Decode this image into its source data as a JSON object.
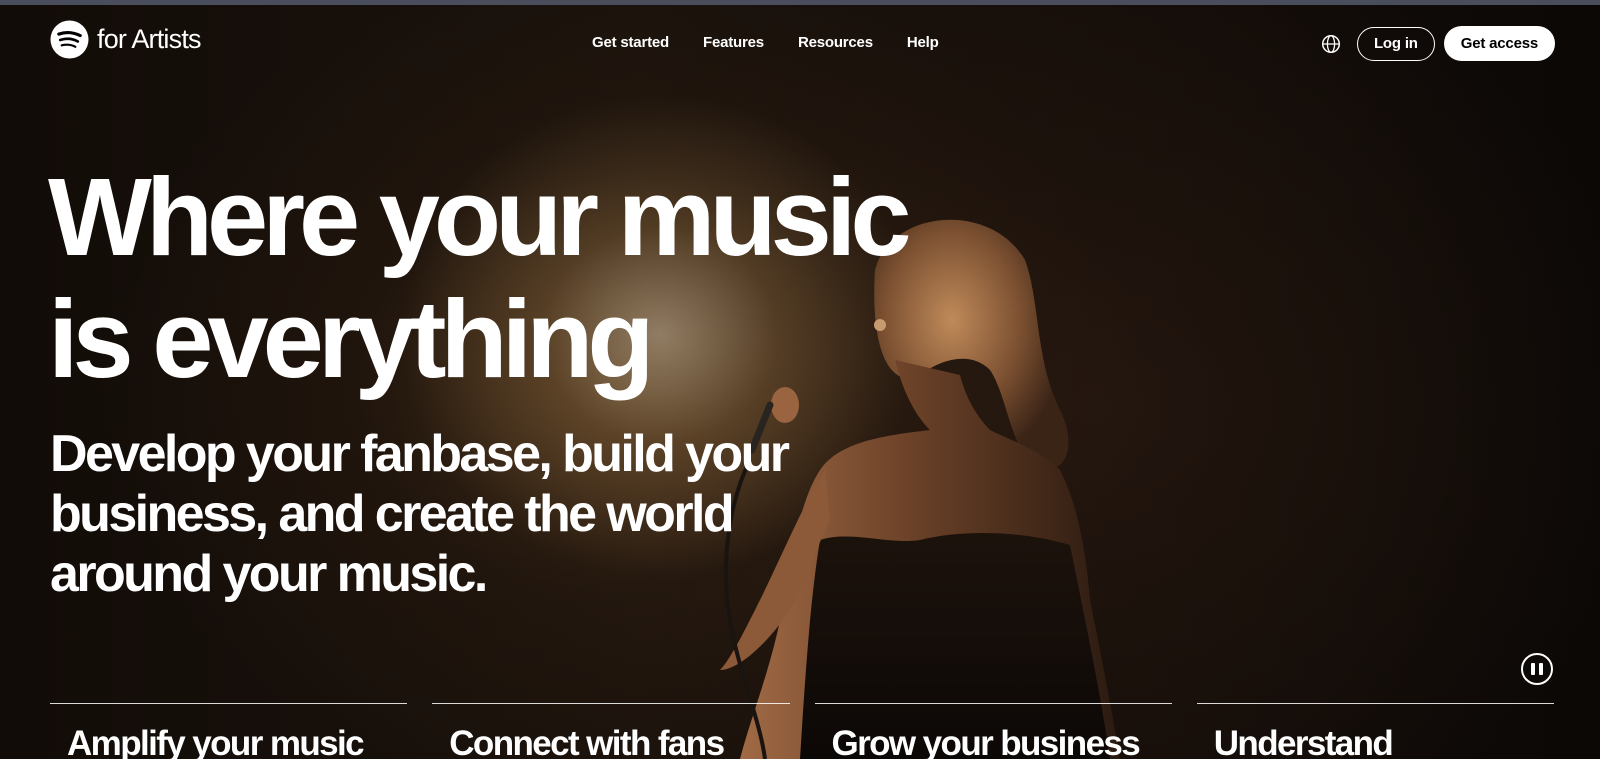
{
  "brand": {
    "logo_icon": "spotify-logo-icon",
    "text": "for Artists"
  },
  "nav": {
    "links": [
      "Get started",
      "Features",
      "Resources",
      "Help"
    ],
    "language_icon": "globe-icon",
    "login_label": "Log in",
    "access_label": "Get access"
  },
  "hero": {
    "headline_line1": "Where your music",
    "headline_line2": "is everything",
    "subhead": "Develop your fanbase, build your business, and create the world around your music.",
    "pause_icon": "pause-icon"
  },
  "features": [
    {
      "title": "Amplify your music"
    },
    {
      "title": "Connect with fans"
    },
    {
      "title": "Grow your business"
    },
    {
      "title": "Understand"
    }
  ],
  "colors": {
    "background": "#0c0907",
    "text": "#ffffff",
    "button_bg": "#ffffff",
    "button_text": "#000000"
  }
}
